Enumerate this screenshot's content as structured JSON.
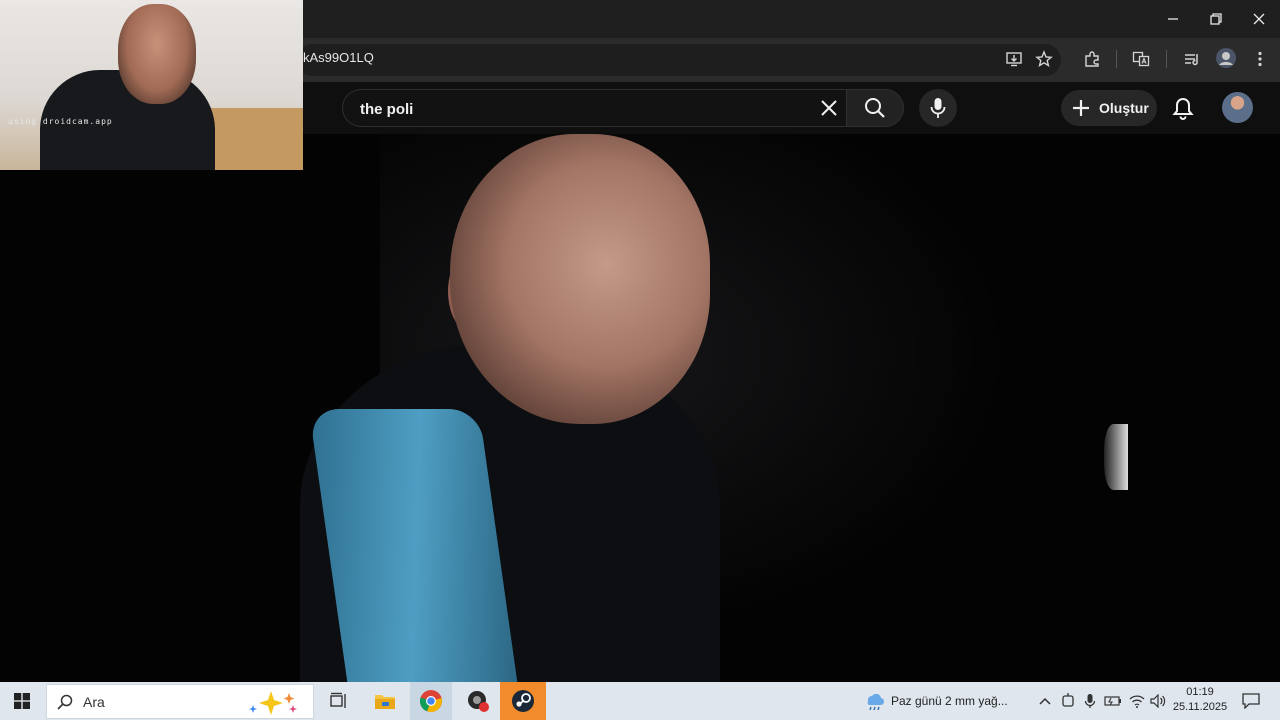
{
  "browser": {
    "url_fragment": "kAs99O1LQ"
  },
  "youtube": {
    "search_query": "the poli",
    "create_label": "Oluştur"
  },
  "webcam": {
    "watermark": "using droidcam.app"
  },
  "taskbar": {
    "search_label": "Ara",
    "weather": "Paz günü 2 mm yağ...",
    "time": "01:19",
    "date": "25.11.2025"
  },
  "icons": {
    "browser": [
      "minimize-icon",
      "restore-icon",
      "close-icon",
      "install-app-icon",
      "bookmark-star-icon",
      "extensions-icon",
      "translate-icon",
      "reading-list-icon",
      "profile-icon",
      "kebab-menu-icon"
    ],
    "youtube": [
      "clear-icon",
      "search-icon",
      "mic-icon",
      "plus-icon",
      "bell-icon",
      "avatar"
    ],
    "taskbar": [
      "windows-start-icon",
      "search-icon",
      "copilot-sparkle-icon",
      "task-view-icon",
      "file-explorer-icon",
      "chrome-icon",
      "app-icon",
      "steam-icon",
      "weather-icon",
      "chevron-up-icon",
      "battery-icon",
      "wifi-icon",
      "volume-icon",
      "notification-icon"
    ]
  }
}
